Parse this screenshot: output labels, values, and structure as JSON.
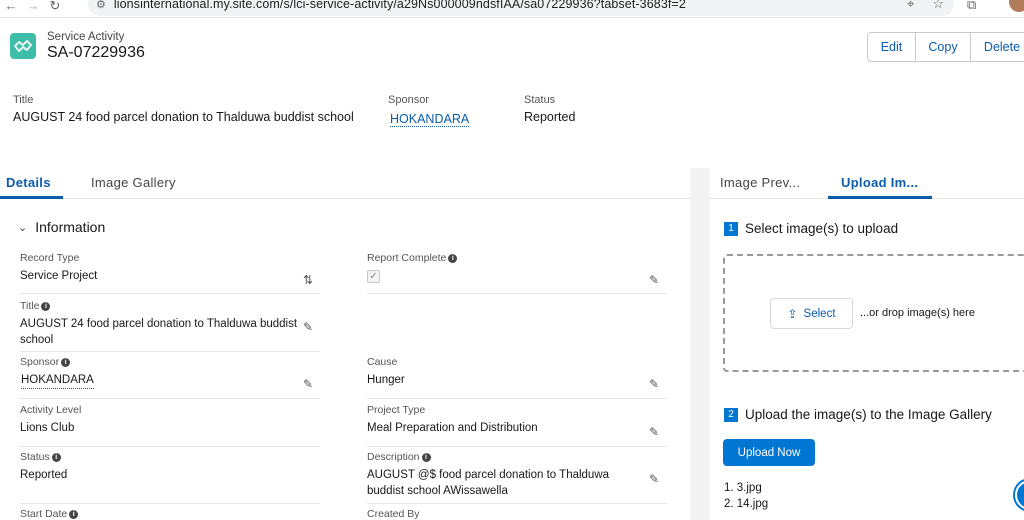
{
  "browser": {
    "url": "lionsinternational.my.site.com/s/lci-service-activity/a29Ns000009ndsfIAA/sa07229936?tabset-3683f=2"
  },
  "header": {
    "record_type": "Service Activity",
    "record_name": "SA-07229936",
    "actions": {
      "edit": "Edit",
      "copy": "Copy",
      "delete": "Delete"
    },
    "highlights": {
      "title_label": "Title",
      "title_value": "AUGUST 24 food parcel donation to Thalduwa buddist school",
      "sponsor_label": "Sponsor",
      "sponsor_value": "HOKANDARA",
      "status_label": "Status",
      "status_value": "Reported"
    }
  },
  "left_tabs": {
    "details": "Details",
    "gallery": "Image Gallery"
  },
  "information": {
    "title": "Information",
    "fields": {
      "record_type_label": "Record Type",
      "record_type_value": "Service Project",
      "report_complete_label": "Report Complete",
      "title_label": "Title",
      "title_value_line1": "AUGUST 24 food parcel donation to Thalduwa buddist",
      "title_value_line2": "school",
      "sponsor_label": "Sponsor",
      "sponsor_value": "HOKANDARA",
      "cause_label": "Cause",
      "cause_value": "Hunger",
      "activity_level_label": "Activity Level",
      "activity_level_value": "Lions Club",
      "project_type_label": "Project Type",
      "project_type_value": "Meal Preparation and Distribution",
      "status_label": "Status",
      "status_value": "Reported",
      "description_label": "Description",
      "description_line1": "AUGUST @$ food parcel donation to Thalduwa",
      "description_line2": "buddist school AWissawella",
      "start_date_label": "Start Date",
      "created_by_label": "Created By"
    }
  },
  "right_panel": {
    "tabs": {
      "preview": "Image Prev...",
      "upload": "Upload Im..."
    },
    "step1_num": "1",
    "step1_text": "Select image(s) to upload",
    "select_label": "Select",
    "drop_text": "...or drop image(s) here",
    "step2_num": "2",
    "step2_text": "Upload the image(s) to the Image Gallery",
    "upload_now": "Upload Now",
    "files": [
      "1. 3.jpg",
      "2. 14.jpg"
    ]
  }
}
